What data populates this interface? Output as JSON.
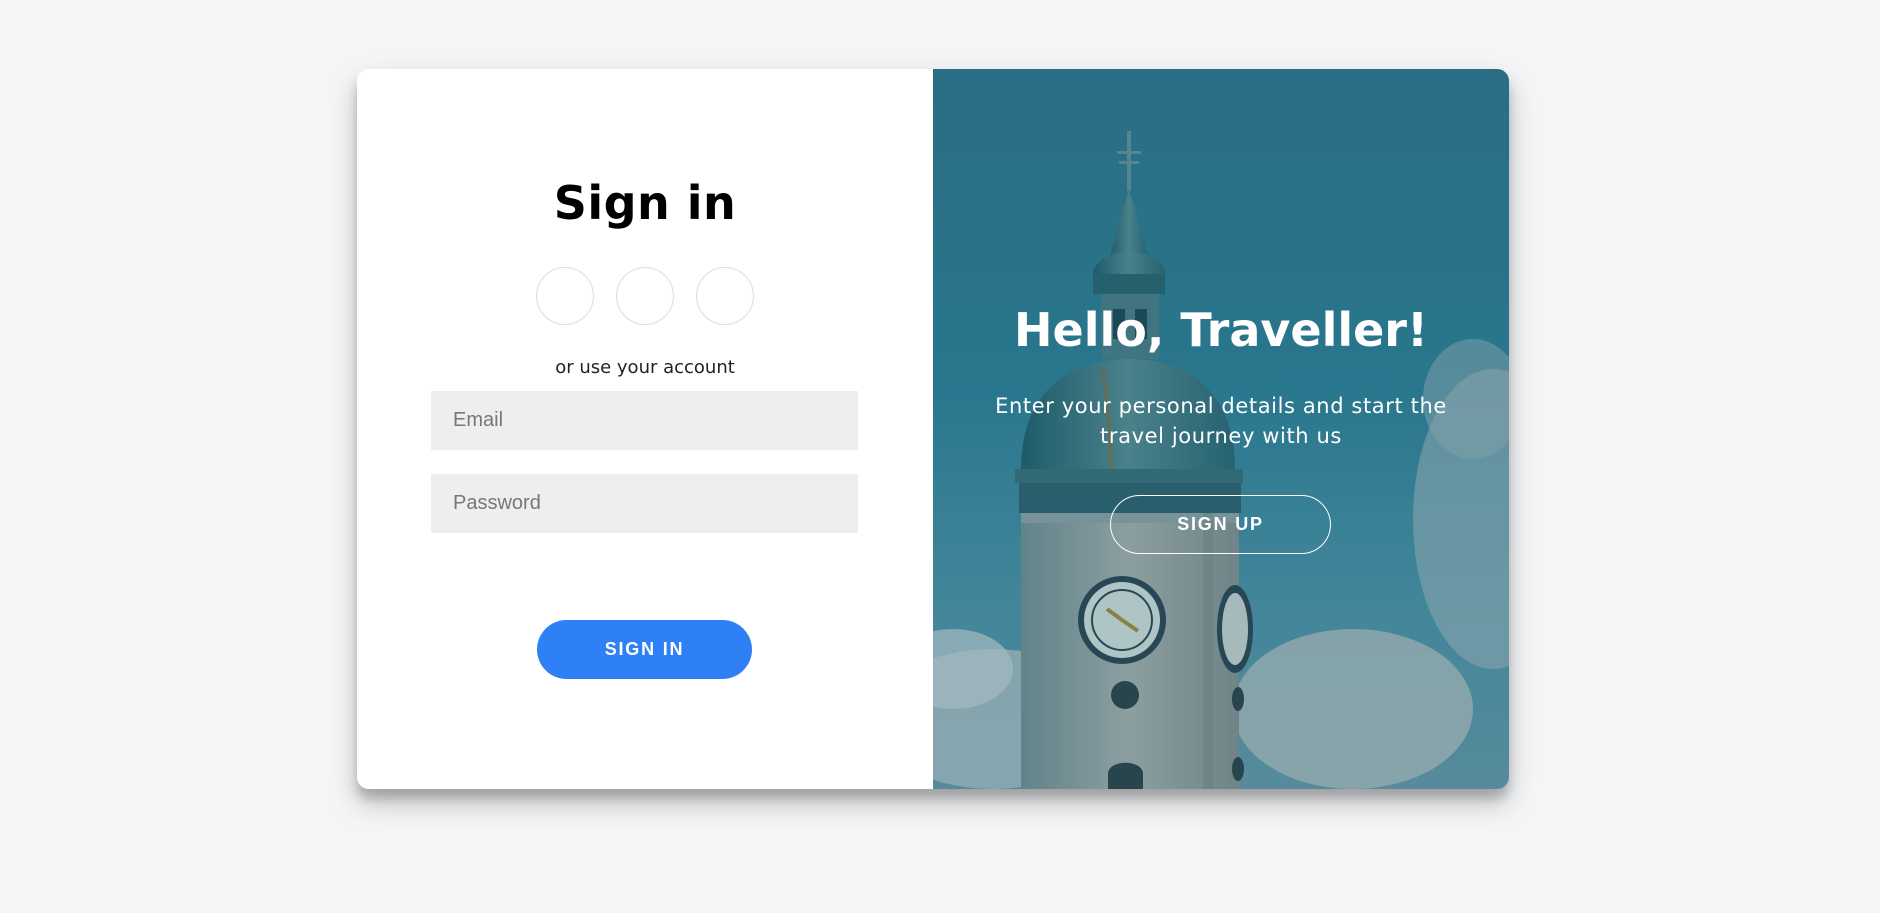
{
  "signin": {
    "title": "Sign in",
    "social_icons": [
      "social-button-1",
      "social-button-2",
      "social-button-3"
    ],
    "alt_text": "or use your account",
    "email_placeholder": "Email",
    "password_placeholder": "Password",
    "button_label": "SIGN IN",
    "button_color": "#2f80f7"
  },
  "overlay": {
    "title": "Hello, Traveller!",
    "text": "Enter your personal details and start the travel journey with us",
    "button_label": "SIGN UP"
  }
}
